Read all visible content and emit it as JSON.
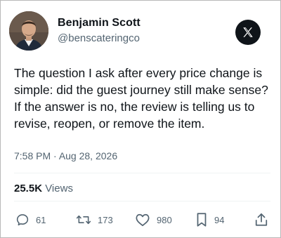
{
  "author": {
    "name": "Benjamin Scott",
    "handle": "@benscateringco"
  },
  "tweet": {
    "text": "The question I ask after every price change is simple: did the guest journey still make sense? If the answer is no, the review is telling us to revise, reopen, or remove the item.",
    "time": "7:58 PM",
    "separator": " · ",
    "date": "Aug 28, 2026"
  },
  "stats": {
    "views_count": "25.5K",
    "views_label": " Views"
  },
  "actions": {
    "replies": "61",
    "retweets": "173",
    "likes": "980",
    "bookmarks": "94"
  },
  "icons": {
    "brand": "x-logo-icon",
    "reply": "reply-icon",
    "retweet": "retweet-icon",
    "like": "heart-icon",
    "bookmark": "bookmark-icon",
    "share": "share-icon"
  },
  "colors": {
    "text": "#0f1419",
    "secondary": "#536471",
    "divider": "#eff3f4",
    "brand": "#0f1419"
  }
}
